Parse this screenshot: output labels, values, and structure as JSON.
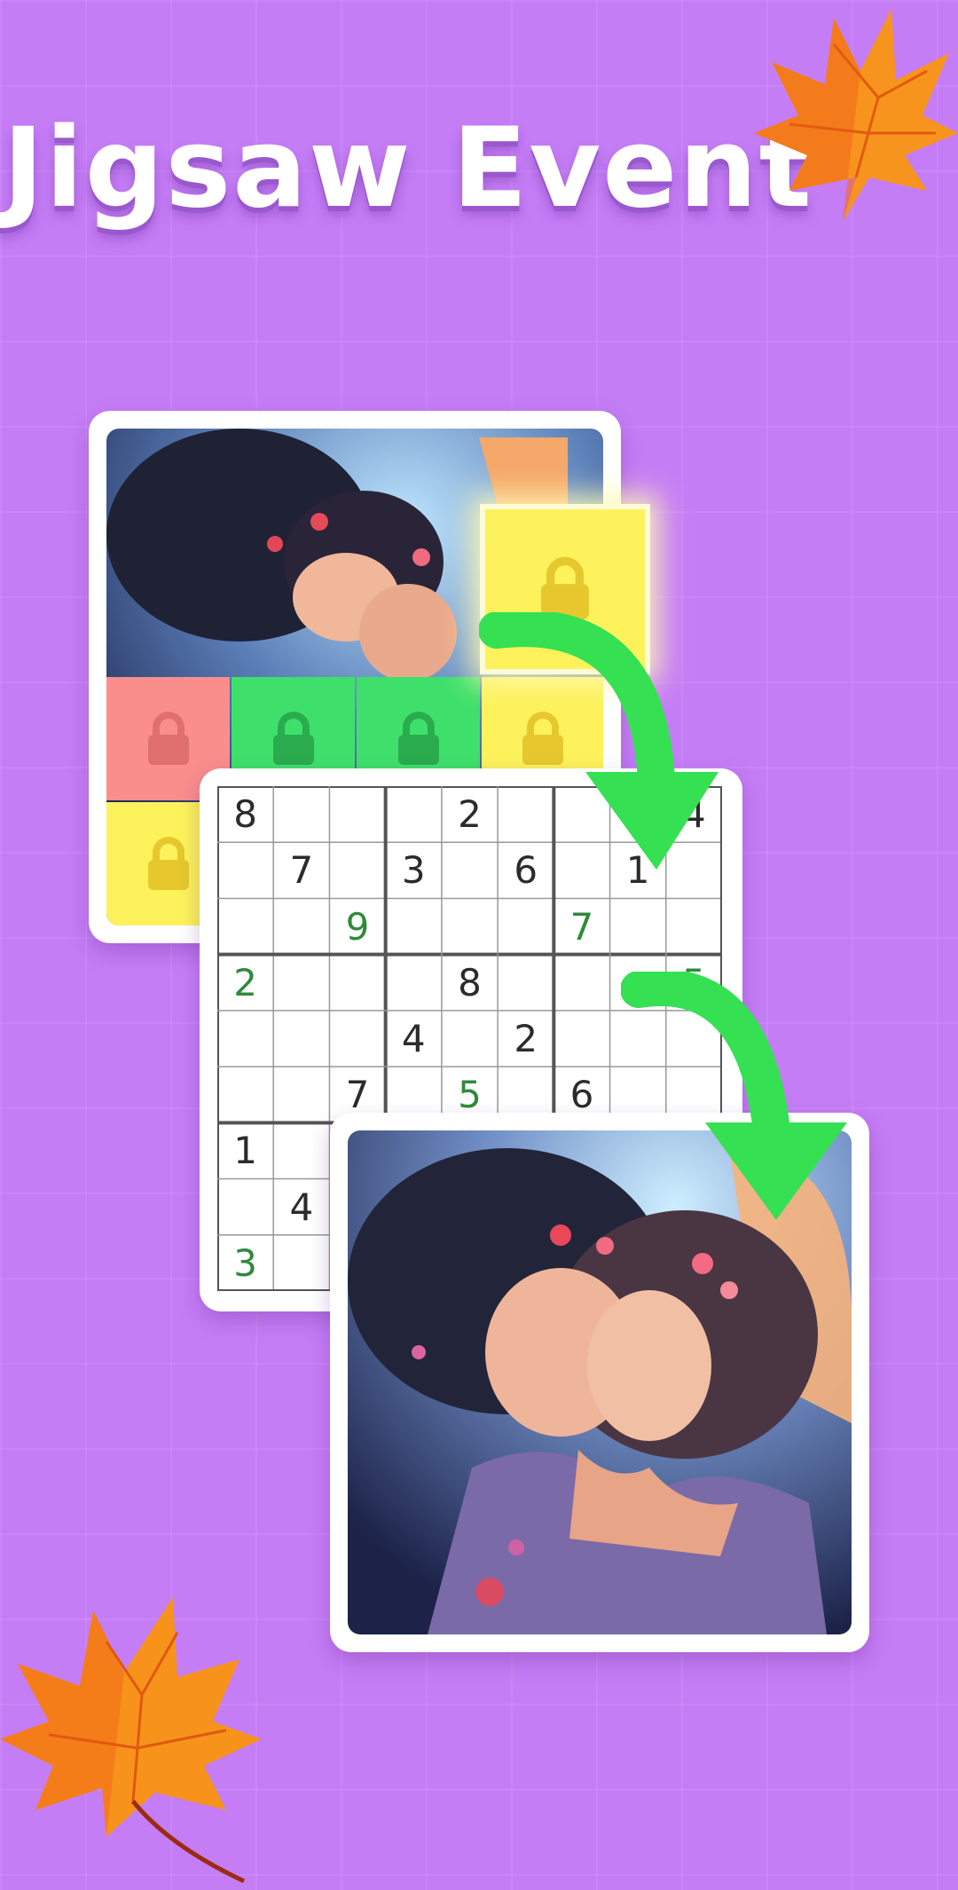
{
  "title": "Jigsaw Event",
  "colors": {
    "background": "#c57df6",
    "locked_red": "#f98e8c",
    "locked_green": "#3ee06b",
    "locked_yellow": "#fdf25b",
    "arrow": "#35e052",
    "sudoku_given": "#2b2b2b",
    "sudoku_filled": "#2f8a3b"
  },
  "icons": [
    "maple-leaf-icon",
    "lock-icon",
    "curved-arrow-icon"
  ],
  "puzzle_tiles": [
    {
      "color": "red",
      "locked": true
    },
    {
      "color": "green",
      "locked": true
    },
    {
      "color": "green",
      "locked": true
    },
    {
      "color": "yellow",
      "locked": true
    },
    {
      "color": "yellow",
      "locked": true
    },
    {
      "color": "yellow",
      "locked": true,
      "highlighted": true
    }
  ],
  "sudoku": {
    "given": [
      {
        "r": 0,
        "c": 0,
        "v": "8"
      },
      {
        "r": 0,
        "c": 4,
        "v": "2"
      },
      {
        "r": 0,
        "c": 8,
        "v": "4"
      },
      {
        "r": 1,
        "c": 1,
        "v": "7"
      },
      {
        "r": 1,
        "c": 3,
        "v": "3"
      },
      {
        "r": 1,
        "c": 5,
        "v": "6"
      },
      {
        "r": 1,
        "c": 7,
        "v": "1"
      },
      {
        "r": 3,
        "c": 4,
        "v": "8"
      },
      {
        "r": 4,
        "c": 3,
        "v": "4"
      },
      {
        "r": 4,
        "c": 5,
        "v": "2"
      },
      {
        "r": 5,
        "c": 2,
        "v": "7"
      },
      {
        "r": 5,
        "c": 6,
        "v": "6"
      },
      {
        "r": 6,
        "c": 0,
        "v": "1"
      },
      {
        "r": 7,
        "c": 1,
        "v": "4"
      }
    ],
    "filled": [
      {
        "r": 2,
        "c": 2,
        "v": "9"
      },
      {
        "r": 2,
        "c": 6,
        "v": "7"
      },
      {
        "r": 3,
        "c": 0,
        "v": "2"
      },
      {
        "r": 3,
        "c": 8,
        "v": "5"
      },
      {
        "r": 5,
        "c": 4,
        "v": "5"
      },
      {
        "r": 8,
        "c": 0,
        "v": "3"
      }
    ]
  }
}
